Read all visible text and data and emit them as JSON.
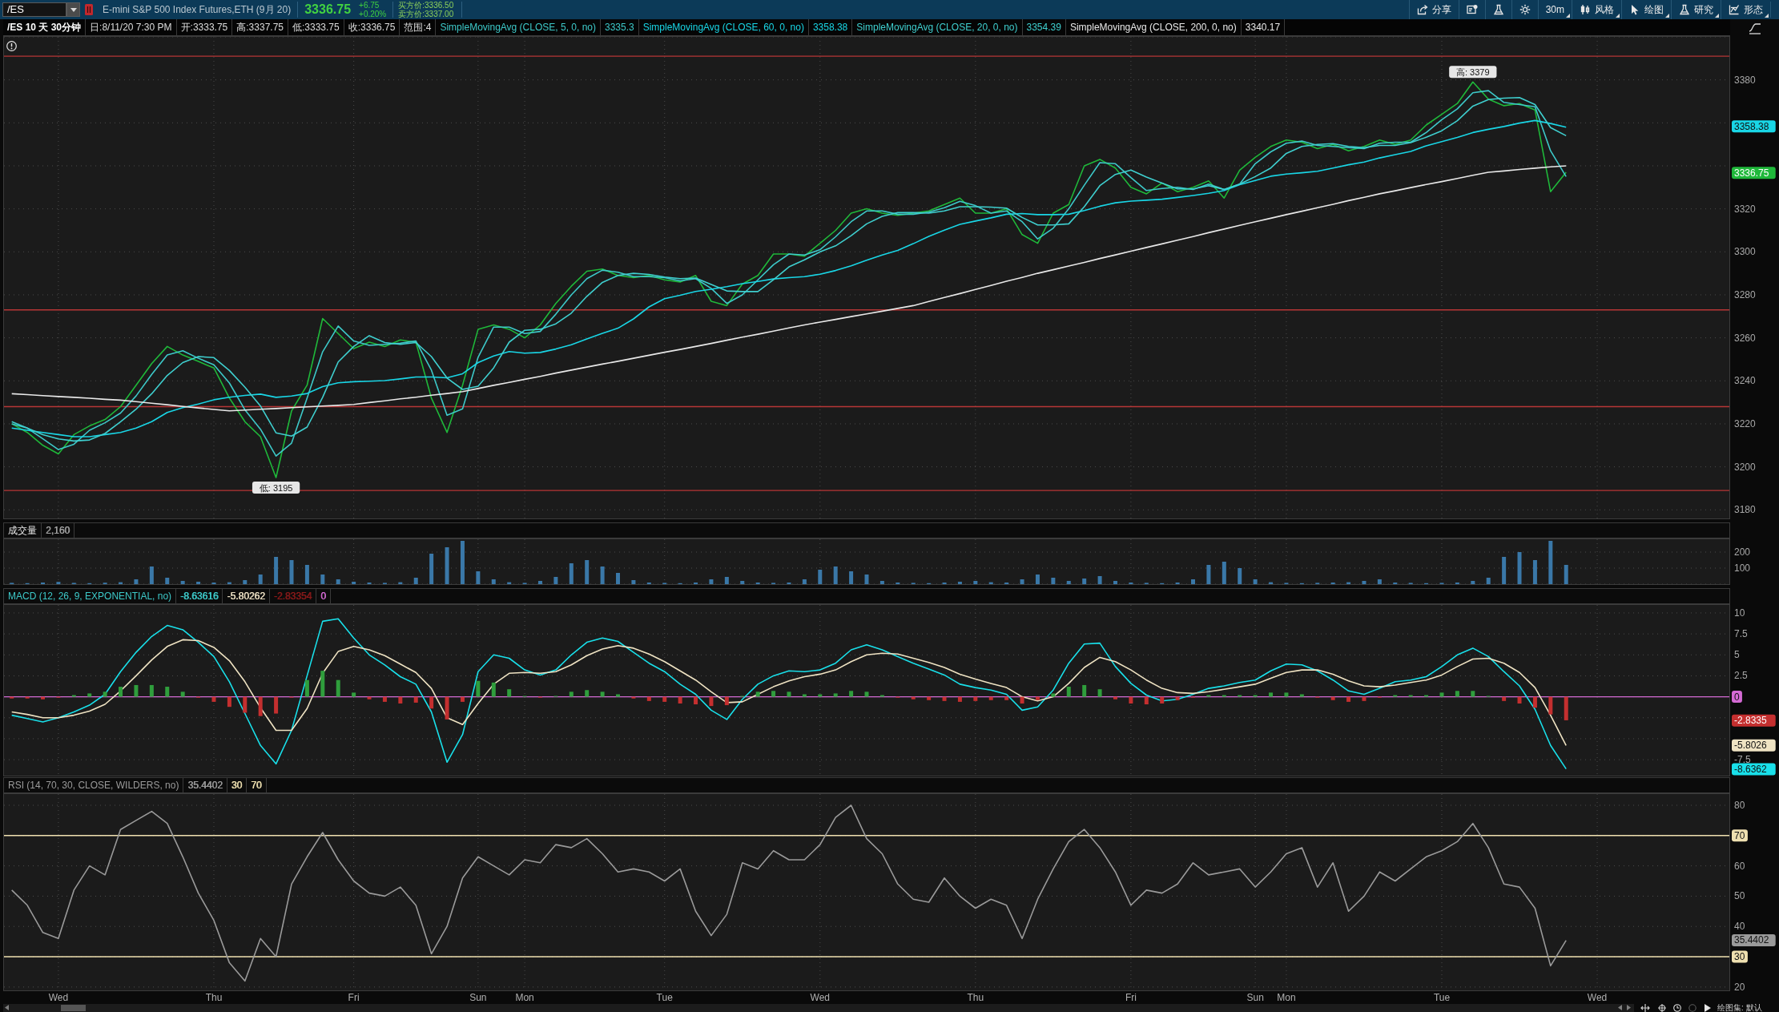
{
  "toolbar": {
    "symbol": "/ES",
    "description": "E-mini S&P 500 Index Futures,ETH (9月 20)",
    "last": "3336.75",
    "change": [
      "+6.75",
      "+0.20%"
    ],
    "quote": [
      "买方价:3336.50",
      "卖方价:3337.00"
    ],
    "buttons": [
      {
        "kind": "share",
        "label": "分享",
        "dropdown": false
      },
      {
        "kind": "card",
        "dropdown": false
      },
      {
        "kind": "flask",
        "dropdown": false
      },
      {
        "kind": "gear",
        "dropdown": false
      },
      {
        "kind": "interval",
        "label": "30m",
        "dropdown": true
      },
      {
        "kind": "candles",
        "label": "风格",
        "dropdown": true
      },
      {
        "kind": "cursor",
        "label": "绘图",
        "dropdown": true
      },
      {
        "kind": "flask",
        "label": "研究",
        "dropdown": true
      },
      {
        "kind": "pattern",
        "label": "形态",
        "dropdown": true
      }
    ]
  },
  "main": {
    "header": {
      "title": "/ES 10 天 30分钟",
      "fields": [
        "日:8/11/20 7:30 PM",
        "开:3333.75",
        "高:3337.75",
        "低:3333.75",
        "收:3336.75",
        "范围:4"
      ],
      "studies": [
        {
          "label": "SimpleMovingAvg (CLOSE, 5, 0, no)",
          "value": "3335.3"
        },
        {
          "label": "SimpleMovingAvg (CLOSE, 60, 0, no)",
          "value": "3358.38"
        },
        {
          "label": "SimpleMovingAvg (CLOSE, 20, 0, no)",
          "value": "3354.39"
        },
        {
          "label": "SimpleMovingAvg (CLOSE, 200, 0, no)",
          "value": "3340.17"
        }
      ]
    },
    "chart_data": {
      "type": "line",
      "categories": [
        null,
        null,
        null,
        null,
        null,
        null,
        null,
        null,
        null,
        null,
        null,
        null,
        null,
        null,
        null,
        null,
        null,
        null,
        null,
        null,
        null,
        null,
        null,
        null,
        null,
        null,
        null,
        null,
        null,
        null,
        null,
        null,
        null,
        null,
        null,
        null,
        null,
        null,
        null,
        null,
        null,
        null,
        null,
        null,
        null,
        null,
        null,
        null,
        null,
        null,
        null,
        null,
        null,
        null,
        null,
        null,
        null,
        null,
        null,
        null,
        null,
        null,
        null,
        null,
        null,
        null,
        null,
        null,
        null,
        null,
        null,
        null,
        null,
        null,
        null,
        null,
        null,
        null,
        null,
        null,
        null,
        null,
        null,
        null,
        null,
        null,
        null,
        null,
        null,
        null,
        null,
        null,
        null,
        null,
        null,
        null,
        null,
        null,
        null,
        null,
        null,
        null,
        null,
        null,
        null,
        null,
        null,
        null,
        null,
        null,
        null
      ],
      "ylim": [
        3176,
        3400
      ],
      "yticks": [
        3180,
        3200,
        3220,
        3240,
        3260,
        3280,
        3300,
        3320,
        3380
      ],
      "grid": true,
      "series": [
        {
          "color": "#1fb83a",
          "values": [
            3220,
            3216,
            3210,
            3206,
            3215,
            3219,
            3222,
            3228,
            3238,
            3248,
            3256,
            3252,
            3249,
            3246,
            3232,
            3221,
            3214,
            3195,
            3226,
            3238,
            3269,
            3262,
            3255,
            3258,
            3256,
            3259,
            3258,
            3232,
            3216,
            3238,
            3264,
            3266,
            3264,
            3260,
            3266,
            3276,
            3284,
            3291,
            3292,
            3289,
            3288,
            3289,
            3287,
            3286,
            3289,
            3277,
            3275,
            3285,
            3289,
            3299,
            3299,
            3298,
            3304,
            3310,
            3318,
            3320,
            3318,
            3317,
            3318,
            3319,
            3322,
            3325,
            3318,
            3318,
            3320,
            3308,
            3304,
            3318,
            3322,
            3340,
            3343,
            3339,
            3330,
            3327,
            3332,
            3328,
            3330,
            3333,
            3325,
            3338,
            3344,
            3349,
            3352,
            3351,
            3348,
            3350,
            3347,
            3349,
            3352,
            3350,
            3352,
            3359,
            3364,
            3369,
            3379,
            3371,
            3368,
            3369,
            3366,
            3328,
            3337,
            null,
            null,
            null,
            null,
            null,
            null,
            null,
            null,
            null,
            null
          ]
        },
        {
          "color": "#3dc9c9",
          "values": [
            3220,
            3218,
            3213,
            3208,
            3210.5,
            3217,
            3220.5,
            3225,
            3233,
            3243,
            3252,
            3254,
            3250.5,
            3247.5,
            3239,
            3226.5,
            3217.5,
            3205,
            3211,
            3232,
            3253.5,
            3265.5,
            3258.5,
            3256.5,
            3257,
            3257.5,
            3258.5,
            3245,
            3224,
            3227,
            3251,
            3265,
            3265,
            3262,
            3263,
            3271,
            3280,
            3287.5,
            3291.5,
            3290.5,
            3288.5,
            3288.5,
            3288,
            3286.5,
            3287.5,
            3283,
            3276,
            3280,
            3287,
            3294,
            3299,
            3298.5,
            3301,
            3307,
            3314,
            3319,
            3319,
            3317.5,
            3317.5,
            3318.5,
            3320.5,
            3323.5,
            3321.5,
            3318,
            3319,
            3314,
            3306,
            3311,
            3320,
            3331,
            3341.5,
            3341,
            3334.5,
            3328.5,
            3329.5,
            3330,
            3329,
            3331.5,
            3329,
            3331.5,
            3341,
            3346.5,
            3350.5,
            3351.5,
            3349.5,
            3349,
            3348.5,
            3348,
            3350.5,
            3351,
            3351,
            3355.5,
            3361.5,
            3366.5,
            3374,
            3375,
            3369.5,
            3368.5,
            3367.5,
            3347,
            3335,
            null,
            null,
            null,
            null,
            null,
            null,
            null,
            null,
            null,
            null
          ]
        },
        {
          "color": "#19d6e6",
          "values": [
            3218,
            3217,
            3216,
            3215,
            3214,
            3214,
            3215,
            3216,
            3218,
            3221,
            3225.3,
            3227.5,
            3229.2,
            3231.2,
            3232.4,
            3233.2,
            3233.8,
            3232.3,
            3232.9,
            3234.1,
            3237.3,
            3239.1,
            3239.6,
            3239.8,
            3240.1,
            3240.9,
            3241.8,
            3241.8,
            3241.4,
            3243.3,
            3248.5,
            3251.6,
            3253.6,
            3252.9,
            3253.2,
            3254.8,
            3256.8,
            3259.5,
            3262.1,
            3264.5,
            3268.8,
            3274.4,
            3278.2,
            3279.8,
            3281.6,
            3282.6,
            3283.8,
            3285.2,
            3286.2,
            3287.4,
            3288,
            3288.5,
            3289.6,
            3291.3,
            3293.5,
            3296.1,
            3298.5,
            3300.7,
            3303.8,
            3307.2,
            3310.1,
            3312.8,
            3314.3,
            3315.8,
            3317.5,
            3317.8,
            3317.3,
            3317.3,
            3317.5,
            3319.2,
            3321.2,
            3322.8,
            3323.6,
            3324,
            3324.5,
            3325.3,
            3326.2,
            3327.2,
            3328.5,
            3331.2,
            3333.2,
            3335.2,
            3336.2,
            3336.8,
            3337.5,
            3339,
            3340.5,
            3341.8,
            3343.7,
            3345.2,
            3346.7,
            3349.3,
            3351.3,
            3353.2,
            3355.5,
            3357,
            3358.3,
            3359.9,
            3361.1,
            3359.7,
            3358,
            null,
            null,
            null,
            null,
            null,
            null,
            null,
            null,
            null,
            null
          ]
        },
        {
          "color": "#3fcfcf",
          "values": [
            3221,
            3218,
            3215,
            3213,
            3212,
            3212.5,
            3215.5,
            3221,
            3226.8,
            3234,
            3242.5,
            3248.5,
            3251.3,
            3250.8,
            3244.8,
            3237,
            3228.3,
            3215.8,
            3214.3,
            3218.5,
            3232.3,
            3248.8,
            3256,
            3261,
            3257.8,
            3257,
            3257.8,
            3251.3,
            3241.3,
            3236,
            3237.5,
            3246,
            3258,
            3263.5,
            3264,
            3266.5,
            3271.5,
            3279.3,
            3285.8,
            3289,
            3290,
            3289.5,
            3288.3,
            3287.5,
            3287.8,
            3284.8,
            3281.8,
            3281.5,
            3281.5,
            3287,
            3293,
            3296.3,
            3300,
            3302.8,
            3307.5,
            3313,
            3316.5,
            3318.3,
            3318.3,
            3318,
            3319,
            3321,
            3321,
            3320.8,
            3320.3,
            3316,
            3312.5,
            3312.5,
            3313,
            3321,
            3330.8,
            3336,
            3338,
            3334.8,
            3332,
            3329.3,
            3329.3,
            3330.8,
            3329,
            3331.5,
            3335,
            3339,
            3345.8,
            3349,
            3350,
            3350.3,
            3349,
            3348.5,
            3349.5,
            3349.5,
            3350.8,
            3353.3,
            3356.3,
            3361,
            3367.8,
            3370.8,
            3371.5,
            3371.8,
            3368.5,
            3357.8,
            3354,
            null,
            null,
            null,
            null,
            null,
            null,
            null,
            null,
            null,
            null
          ]
        },
        {
          "color": "#e8e8e8",
          "values": [
            3234,
            3233.6,
            3233.1,
            3232.7,
            3232.3,
            3231.9,
            3231.4,
            3231,
            3230.3,
            3229.6,
            3228.9,
            3228.1,
            3227.4,
            3226.7,
            3226,
            3226.4,
            3226.8,
            3227.1,
            3227.5,
            3227.9,
            3228.3,
            3228.6,
            3229,
            3229.9,
            3230.7,
            3231.6,
            3232.4,
            3233.3,
            3234.1,
            3235,
            3236.4,
            3237.9,
            3239.3,
            3240.7,
            3242.1,
            3243.6,
            3245,
            3246.4,
            3247.8,
            3249.1,
            3250.5,
            3251.9,
            3253.3,
            3254.6,
            3256,
            3257.4,
            3258.9,
            3260.3,
            3261.7,
            3263.1,
            3264.6,
            3266,
            3267.3,
            3268.6,
            3269.9,
            3271.1,
            3272.4,
            3273.7,
            3275,
            3276.9,
            3278.8,
            3280.6,
            3282.5,
            3284.4,
            3286.3,
            3288.1,
            3290,
            3291.7,
            3293.4,
            3295.1,
            3296.9,
            3298.6,
            3300.3,
            3302,
            3303.7,
            3305.4,
            3307.1,
            3308.9,
            3310.6,
            3312.3,
            3314,
            3315.6,
            3317.3,
            3318.9,
            3320.5,
            3322.1,
            3323.8,
            3325.4,
            3327,
            3328.4,
            3329.9,
            3331.3,
            3332.7,
            3334.1,
            3335.6,
            3337,
            3337.6,
            3338.3,
            3338.9,
            3339.5,
            3340,
            null,
            null,
            null,
            null,
            null,
            null,
            null,
            null,
            null,
            null
          ]
        }
      ],
      "ref_lines": [
        {
          "axis": "y",
          "value": 3391,
          "color": "#b73636"
        },
        {
          "axis": "y",
          "value": 3273,
          "color": "#b73636"
        },
        {
          "axis": "y",
          "value": 3228,
          "color": "#b73636"
        },
        {
          "axis": "y",
          "value": 3189,
          "color": "#b73636"
        }
      ],
      "annotations": [
        {
          "text": "高: 3379",
          "y": 3379
        },
        {
          "text": "低: 3195",
          "y": 3195
        },
        "3358.38",
        "3336.75"
      ]
    }
  },
  "volume": {
    "header": {
      "title": "成交量",
      "readings": [
        {
          "text": "2,160",
          "color": "#a0a0a0"
        }
      ]
    },
    "chart_data": {
      "type": "bar",
      "categories": [
        null,
        null,
        null,
        null,
        null,
        null,
        null,
        null,
        null,
        null,
        null,
        null,
        null,
        null,
        null,
        null,
        null,
        null,
        null,
        null,
        null,
        null,
        null,
        null,
        null,
        null,
        null,
        null,
        null,
        null,
        null,
        null,
        null,
        null,
        null,
        null,
        null,
        null,
        null,
        null,
        null,
        null,
        null,
        null,
        null,
        null,
        null,
        null,
        null,
        null,
        null,
        null,
        null,
        null,
        null,
        null,
        null,
        null,
        null,
        null,
        null,
        null,
        null,
        null,
        null,
        null,
        null,
        null,
        null,
        null,
        null,
        null,
        null,
        null,
        null,
        null,
        null,
        null,
        null,
        null,
        null,
        null,
        null,
        null,
        null,
        null,
        null,
        null,
        null,
        null,
        null,
        null,
        null,
        null,
        null,
        null,
        null,
        null,
        null,
        null,
        null,
        null,
        null,
        null,
        null,
        null,
        null,
        null,
        null,
        null,
        null
      ],
      "ylim": [
        0,
        280
      ],
      "yticks": [
        100,
        200
      ],
      "grid": true,
      "series": [
        {
          "color": "#3a78a8",
          "values": [
            8,
            6,
            10,
            14,
            8,
            6,
            9,
            12,
            30,
            110,
            40,
            20,
            15,
            10,
            12,
            25,
            60,
            170,
            150,
            120,
            60,
            30,
            15,
            10,
            8,
            12,
            40,
            190,
            230,
            270,
            80,
            30,
            12,
            8,
            20,
            45,
            130,
            150,
            110,
            70,
            25,
            10,
            8,
            6,
            10,
            30,
            45,
            20,
            10,
            8,
            10,
            30,
            90,
            110,
            80,
            60,
            20,
            10,
            8,
            6,
            10,
            15,
            20,
            12,
            10,
            30,
            60,
            40,
            20,
            35,
            50,
            20,
            10,
            8,
            6,
            10,
            30,
            120,
            140,
            100,
            30,
            12,
            8,
            6,
            8,
            10,
            12,
            20,
            30,
            10,
            8,
            6,
            8,
            10,
            20,
            40,
            170,
            200,
            150,
            270,
            120,
            null,
            null,
            null,
            null,
            null,
            null,
            null,
            null,
            null,
            null
          ]
        }
      ]
    }
  },
  "macd": {
    "header": {
      "title": "MACD (12, 26, 9, EXPONENTIAL, no)",
      "color": "#3dc9c9",
      "readings": [
        {
          "text": "-8.63616",
          "color": "#3dc9c9"
        },
        {
          "text": "-5.80262",
          "color": "#e8dcc0"
        },
        {
          "text": "-2.83354",
          "color": "#8b1a1a"
        },
        {
          "text": "0",
          "color": "#d46ad4"
        }
      ]
    },
    "chart_data": {
      "type": "line",
      "categories": [
        null,
        null,
        null,
        null,
        null,
        null,
        null,
        null,
        null,
        null,
        null,
        null,
        null,
        null,
        null,
        null,
        null,
        null,
        null,
        null,
        null,
        null,
        null,
        null,
        null,
        null,
        null,
        null,
        null,
        null,
        null,
        null,
        null,
        null,
        null,
        null,
        null,
        null,
        null,
        null,
        null,
        null,
        null,
        null,
        null,
        null,
        null,
        null,
        null,
        null,
        null,
        null,
        null,
        null,
        null,
        null,
        null,
        null,
        null,
        null,
        null,
        null,
        null,
        null,
        null,
        null,
        null,
        null,
        null,
        null,
        null,
        null,
        null,
        null,
        null,
        null,
        null,
        null,
        null,
        null,
        null,
        null,
        null,
        null,
        null,
        null,
        null,
        null,
        null,
        null,
        null,
        null,
        null,
        null,
        null,
        null,
        null,
        null,
        null,
        null,
        null,
        null,
        null,
        null,
        null,
        null,
        null,
        null,
        null,
        null,
        null
      ],
      "ylim": [
        -9.4,
        10.95
      ],
      "yticks": [
        -7.5,
        2.5,
        5,
        7.5,
        10
      ],
      "grid": true,
      "series": [
        {
          "color": "#19e0ea",
          "values": [
            -2.2,
            -2.6,
            -3.0,
            -2.5,
            -1.8,
            -1.0,
            0.3,
            3.0,
            5.3,
            7.2,
            8.5,
            8.0,
            6.5,
            4.8,
            1.8,
            -2.0,
            -5.8,
            -8.0,
            -4.0,
            2.5,
            9.0,
            9.3,
            7.0,
            5.0,
            3.8,
            2.4,
            1.5,
            -1.8,
            -7.8,
            -4.5,
            3.0,
            5.0,
            4.6,
            3.2,
            2.6,
            3.2,
            5.0,
            6.5,
            7.0,
            6.6,
            5.3,
            4.0,
            3.0,
            1.5,
            0.3,
            -1.6,
            -2.7,
            -0.3,
            1.5,
            2.5,
            3.1,
            3.0,
            3.2,
            4.0,
            5.6,
            6.2,
            5.6,
            4.8,
            4.0,
            3.3,
            2.6,
            1.5,
            1.1,
            0.8,
            0.3,
            -1.6,
            -1.2,
            0.8,
            4.0,
            6.3,
            6.4,
            3.6,
            1.6,
            0.2,
            -0.5,
            -0.3,
            0.3,
            1.0,
            1.3,
            1.7,
            2.0,
            3.1,
            3.9,
            3.8,
            3.1,
            2.0,
            0.7,
            0.3,
            1.0,
            1.8,
            2.0,
            2.4,
            3.6,
            5.0,
            5.8,
            4.8,
            3.0,
            1.3,
            -1.5,
            -5.8,
            -8.6,
            null,
            null,
            null,
            null,
            null,
            null,
            null,
            null,
            null,
            null
          ]
        },
        {
          "color": "#efe3c3",
          "values": [
            -1.8,
            -2.1,
            -2.5,
            -2.5,
            -2.2,
            -1.7,
            -0.9,
            0.7,
            2.5,
            4.4,
            6.0,
            6.8,
            6.7,
            5.9,
            4.3,
            1.8,
            -1.3,
            -4.0,
            -4.0,
            -1.4,
            2.8,
            5.4,
            6.0,
            5.6,
            4.9,
            3.9,
            2.9,
            1.0,
            -2.5,
            -3.3,
            -0.8,
            1.5,
            2.8,
            2.9,
            2.8,
            3.0,
            3.8,
            4.9,
            5.7,
            6.1,
            5.8,
            5.1,
            4.2,
            3.1,
            2.0,
            0.6,
            -0.7,
            -0.6,
            0.3,
            1.2,
            1.9,
            2.4,
            2.7,
            3.2,
            4.2,
            5.0,
            5.2,
            5.1,
            4.6,
            4.1,
            3.5,
            2.7,
            2.1,
            1.6,
            1.1,
            0.0,
            -0.5,
            0.0,
            1.6,
            3.5,
            4.7,
            4.2,
            3.2,
            2.0,
            1.0,
            0.5,
            0.4,
            0.6,
            0.9,
            1.2,
            1.5,
            2.2,
            2.9,
            3.2,
            3.2,
            2.7,
            1.9,
            1.3,
            1.2,
            1.4,
            1.7,
            2.0,
            2.6,
            3.6,
            4.5,
            4.6,
            4.0,
            2.9,
            1.1,
            -2.2,
            -5.8,
            null,
            null,
            null,
            null,
            null,
            null,
            null,
            null,
            null,
            null
          ]
        },
        {
          "type": "bar",
          "color": "#2f9e3c",
          "values": [
            null,
            null,
            null,
            null,
            0.2,
            0.4,
            0.6,
            1.2,
            1.4,
            1.4,
            1.2,
            0.6,
            null,
            null,
            null,
            null,
            null,
            null,
            null,
            2.0,
            3.1,
            2.0,
            0.5,
            null,
            null,
            null,
            null,
            null,
            null,
            null,
            1.9,
            1.7,
            0.9,
            0.1,
            null,
            0.1,
            0.6,
            0.8,
            0.6,
            0.3,
            null,
            null,
            null,
            null,
            null,
            null,
            null,
            0.1,
            0.6,
            0.7,
            0.6,
            0.3,
            0.3,
            0.4,
            0.7,
            0.6,
            0.2,
            null,
            null,
            null,
            null,
            null,
            null,
            null,
            null,
            null,
            null,
            0.4,
            1.2,
            1.4,
            0.9,
            null,
            null,
            null,
            null,
            null,
            null,
            0.2,
            0.2,
            0.2,
            0.2,
            0.5,
            0.5,
            0.3,
            null,
            null,
            null,
            null,
            null,
            0.2,
            0.2,
            0.2,
            0.5,
            0.7,
            0.7,
            0.1,
            null,
            null,
            null,
            null,
            null,
            null,
            null,
            null,
            null,
            null,
            null,
            null,
            null,
            null,
            null
          ]
        },
        {
          "type": "bar",
          "color": "#c42f2f",
          "values": [
            -0.2,
            -0.2,
            -0.3,
            -0.1,
            null,
            null,
            null,
            null,
            null,
            null,
            null,
            null,
            -0.1,
            -0.6,
            -1.2,
            -1.9,
            -2.3,
            -2.0,
            -0.1,
            null,
            null,
            null,
            null,
            -0.3,
            -0.6,
            -0.8,
            -0.7,
            -1.4,
            -2.7,
            -0.6,
            null,
            null,
            null,
            null,
            -0.1,
            null,
            null,
            null,
            null,
            null,
            -0.2,
            -0.5,
            -0.6,
            -0.8,
            -0.9,
            -1.1,
            -1.0,
            null,
            null,
            null,
            null,
            null,
            null,
            null,
            null,
            null,
            null,
            -0.1,
            -0.3,
            -0.4,
            -0.5,
            -0.6,
            -0.5,
            -0.4,
            -0.4,
            -0.8,
            -0.4,
            null,
            null,
            null,
            null,
            -0.3,
            -0.8,
            -0.9,
            -0.8,
            -0.4,
            -0.1,
            null,
            null,
            null,
            null,
            null,
            null,
            null,
            -0.1,
            -0.4,
            -0.6,
            -0.5,
            -0.1,
            null,
            null,
            null,
            null,
            null,
            null,
            null,
            -0.5,
            -0.8,
            -1.3,
            -2.1,
            -2.8,
            null,
            null,
            null,
            null,
            null,
            null,
            null,
            null,
            null,
            null
          ]
        }
      ],
      "ref_lines": [
        {
          "axis": "y",
          "value": 0,
          "color": "#d46ad4"
        }
      ],
      "annotations": [
        "0",
        "-2.8335",
        "-5.8026",
        "-8.6362"
      ]
    }
  },
  "rsi": {
    "header": {
      "title": "RSI (14, 70, 30, CLOSE, WILDERS, no)",
      "color": "#9a9a9a",
      "readings": [
        {
          "text": "35.4402",
          "color": "#9a9a9a"
        },
        {
          "text": "30",
          "color": "#efe0b0"
        },
        {
          "text": "70",
          "color": "#efe0b0"
        }
      ]
    },
    "chart_data": {
      "type": "line",
      "categories": [
        null,
        null,
        null,
        "Wed",
        null,
        null,
        null,
        null,
        null,
        null,
        null,
        null,
        null,
        "Thu",
        null,
        null,
        null,
        null,
        null,
        null,
        null,
        null,
        "Fri",
        null,
        null,
        null,
        null,
        null,
        null,
        null,
        "Sun",
        null,
        null,
        "Mon",
        null,
        null,
        null,
        null,
        null,
        null,
        null,
        null,
        "Tue",
        null,
        null,
        null,
        null,
        null,
        null,
        null,
        null,
        null,
        "Wed",
        null,
        null,
        null,
        null,
        null,
        null,
        null,
        null,
        null,
        "Thu",
        null,
        null,
        null,
        null,
        null,
        null,
        null,
        null,
        null,
        "Fri",
        null,
        null,
        null,
        null,
        null,
        null,
        null,
        "Sun",
        null,
        "Mon",
        null,
        null,
        null,
        null,
        null,
        null,
        null,
        null,
        null,
        "Tue",
        null,
        null,
        null,
        null,
        null,
        null,
        null,
        null,
        null,
        "Wed",
        null,
        null,
        null,
        null,
        null,
        null,
        null,
        null
      ],
      "ylim": [
        18.9,
        83.7
      ],
      "yticks": [
        20,
        40,
        50,
        60,
        80
      ],
      "grid": true,
      "series": [
        {
          "color": "#9a9a9a",
          "values": [
            52,
            47,
            38,
            36,
            52,
            60,
            57,
            72,
            75,
            78,
            74,
            63,
            51,
            42,
            28,
            22,
            36,
            30,
            54,
            63,
            71,
            62,
            55,
            51,
            50,
            53,
            47,
            31,
            40,
            56,
            63,
            60,
            57,
            62,
            61,
            67,
            66,
            69,
            64,
            58,
            59,
            58,
            55,
            59,
            45,
            37,
            44,
            61,
            59,
            65,
            62,
            62,
            67,
            76,
            80,
            69,
            64,
            54,
            49,
            48,
            56,
            50,
            46,
            49,
            47,
            36,
            49,
            59,
            68,
            72,
            66,
            58,
            47,
            52,
            51,
            54,
            61,
            57,
            58,
            59,
            53,
            58,
            64,
            66,
            53,
            61,
            45,
            50,
            58,
            55,
            59,
            63,
            65,
            68,
            74,
            66,
            54,
            53,
            46,
            27,
            35.4,
            null,
            null,
            null,
            null,
            null,
            null,
            null,
            null,
            null,
            null
          ]
        }
      ],
      "ref_lines": [
        {
          "axis": "y",
          "value": 30,
          "color": "#efe0b0"
        },
        {
          "axis": "y",
          "value": 70,
          "color": "#efe0b0"
        }
      ],
      "annotations": [
        "70",
        "35.4402",
        "30"
      ]
    }
  },
  "status_bar": {
    "label": "绘图集: 默认"
  }
}
